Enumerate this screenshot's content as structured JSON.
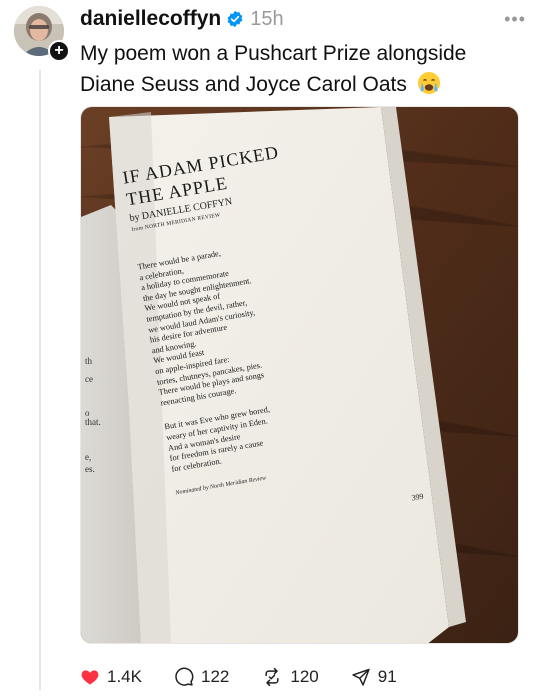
{
  "post": {
    "username": "daniellecoffyn",
    "time": "15h",
    "text_line1": "My poem won a Pushcart Prize alongside",
    "text_line2": "Diane Seuss and Joyce Carol Oats"
  },
  "book_page": {
    "title_line1": "IF ADAM PICKED",
    "title_line2": "THE APPLE",
    "byline": "by DANIELLE COFFYN",
    "source": "from NORTH MERIDIAN REVIEW",
    "stanza1": [
      "There would be a parade,",
      "a celebration,",
      "a holiday to commemorate",
      "the day he sought enlightenment.",
      "We would not speak of",
      "temptation by the devil, rather,",
      "we would laud Adam's curiosity,",
      "his desire for adventure",
      "and knowing.",
      "We would feast",
      "on apple-inspired fare:",
      "tortes, chutneys, pancakes, pies.",
      "There would be plays and songs",
      "reenacting his courage."
    ],
    "stanza2": [
      "But it was Eve who grew bored,",
      "weary of her captivity in Eden.",
      "And a woman's desire",
      "for freedom is rarely a cause",
      "for celebration."
    ],
    "nominated": "Nominated by North Meridian Review",
    "page_number": "399",
    "left_page_fragments": [
      "th",
      "ce",
      "o that.",
      "e,",
      "es."
    ]
  },
  "actions": {
    "likes": "1.4K",
    "comments": "122",
    "reposts": "120",
    "shares": "91"
  },
  "colors": {
    "like": "#ff3040",
    "verified": "#0095f6",
    "muted": "#9a9a9a"
  }
}
